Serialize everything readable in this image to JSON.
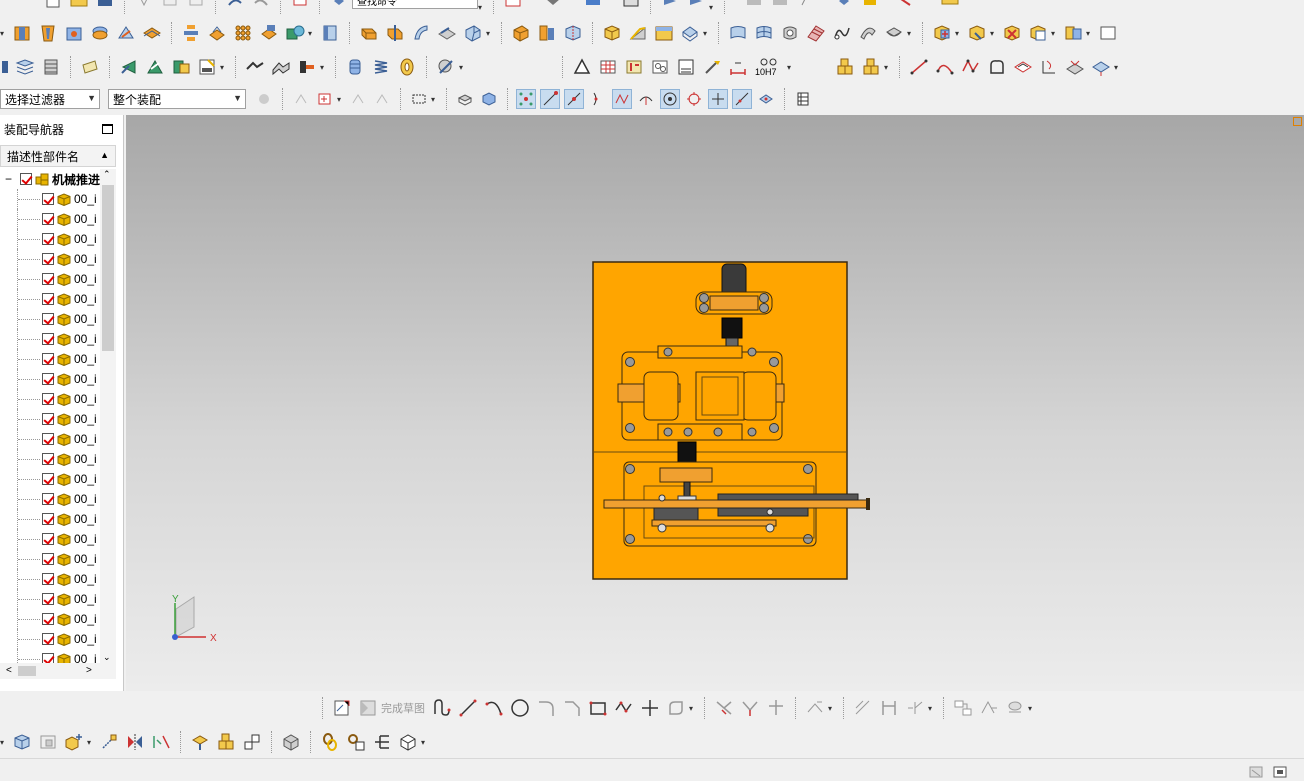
{
  "toolbar_top": {
    "command_finder_value": "查找命令"
  },
  "selection_bar": {
    "type_filter": "选择过滤器",
    "scope_filter": "整个装配"
  },
  "dimension_tool_label": "10H7",
  "assembly_navigator": {
    "title": "装配导航器",
    "column_header": "描述性部件名",
    "root_label": "机械推进",
    "child_label": "00_i",
    "child_count": 25
  },
  "triad": {
    "x_label": "X",
    "y_label": "Y"
  },
  "sketch_toolbar": {
    "finish_sketch_label": "完成草图"
  },
  "colors": {
    "model_orange": "#ffa500",
    "model_outline": "#3a2a10",
    "checkbox_red": "#e00000",
    "part_cube": "#e8b400"
  }
}
